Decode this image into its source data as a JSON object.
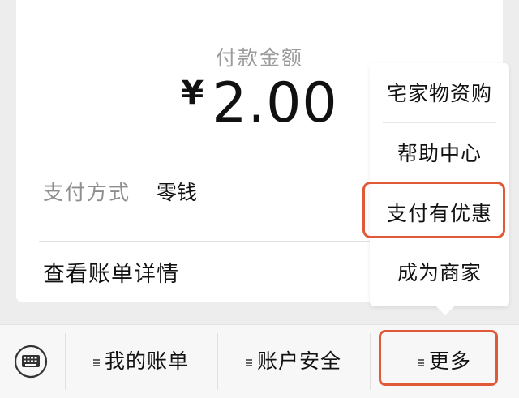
{
  "payment": {
    "amount_label": "付款金额",
    "currency_symbol": "¥",
    "amount": "2.00",
    "method_label": "支付方式",
    "method_value": "零钱",
    "bill_details": "查看账单详情"
  },
  "menu": {
    "items": [
      "宅家物资购",
      "帮助中心",
      "支付有优惠",
      "成为商家"
    ],
    "highlighted_item": "支付有优惠"
  },
  "bottom_bar": {
    "keyboard_icon": "keyboard-icon",
    "tabs": [
      "我的账单",
      "账户安全",
      "更多"
    ],
    "highlighted_tab": "更多"
  },
  "colors": {
    "highlight": "#e05a3a",
    "background": "#ededed",
    "card": "#ffffff",
    "muted_text": "#9b9b9b"
  }
}
